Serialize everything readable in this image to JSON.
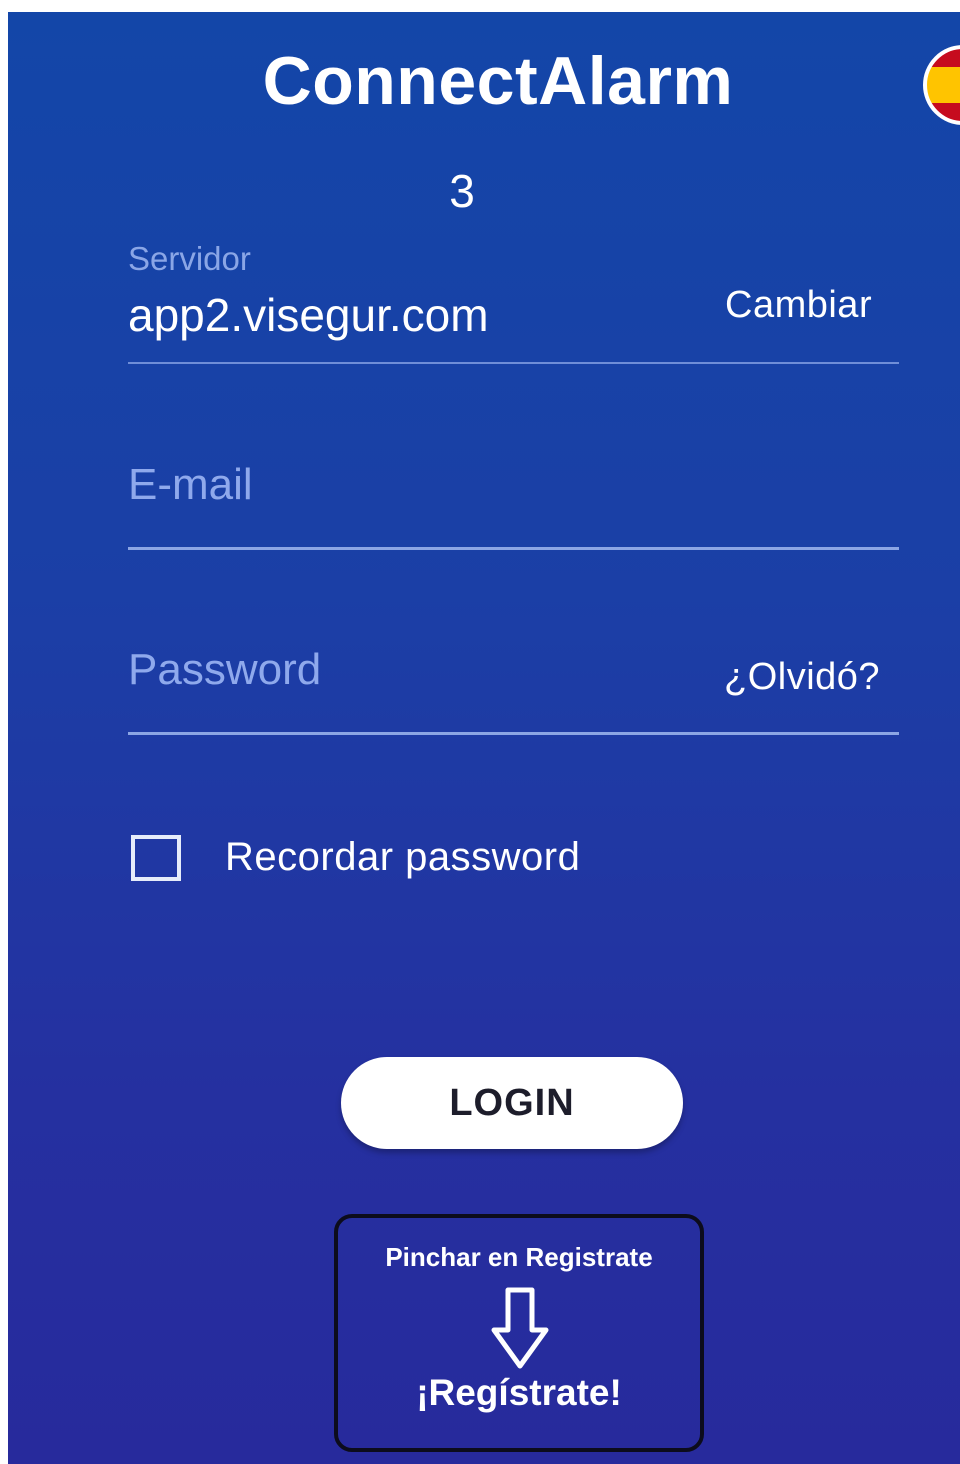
{
  "app": {
    "title": "ConnectAlarm",
    "version": "3"
  },
  "language": {
    "flag_icon": "spain-flag-icon"
  },
  "server": {
    "label": "Servidor",
    "value": "app2.visegur.com",
    "change_label": "Cambiar"
  },
  "email": {
    "placeholder": "E-mail"
  },
  "password": {
    "placeholder": "Password",
    "forgot_label": "¿Olvidó?"
  },
  "remember": {
    "label": "Recordar password",
    "checked": false
  },
  "login": {
    "label": "LOGIN"
  },
  "register": {
    "hint": "Pinchar en Registrate",
    "arrow_icon": "arrow-down-icon",
    "label": "¡Regístrate!"
  },
  "colors": {
    "background_top": "#1346a8",
    "background_bottom": "#272a9c",
    "text": "#ffffff",
    "placeholder": "#8fa9ec"
  }
}
